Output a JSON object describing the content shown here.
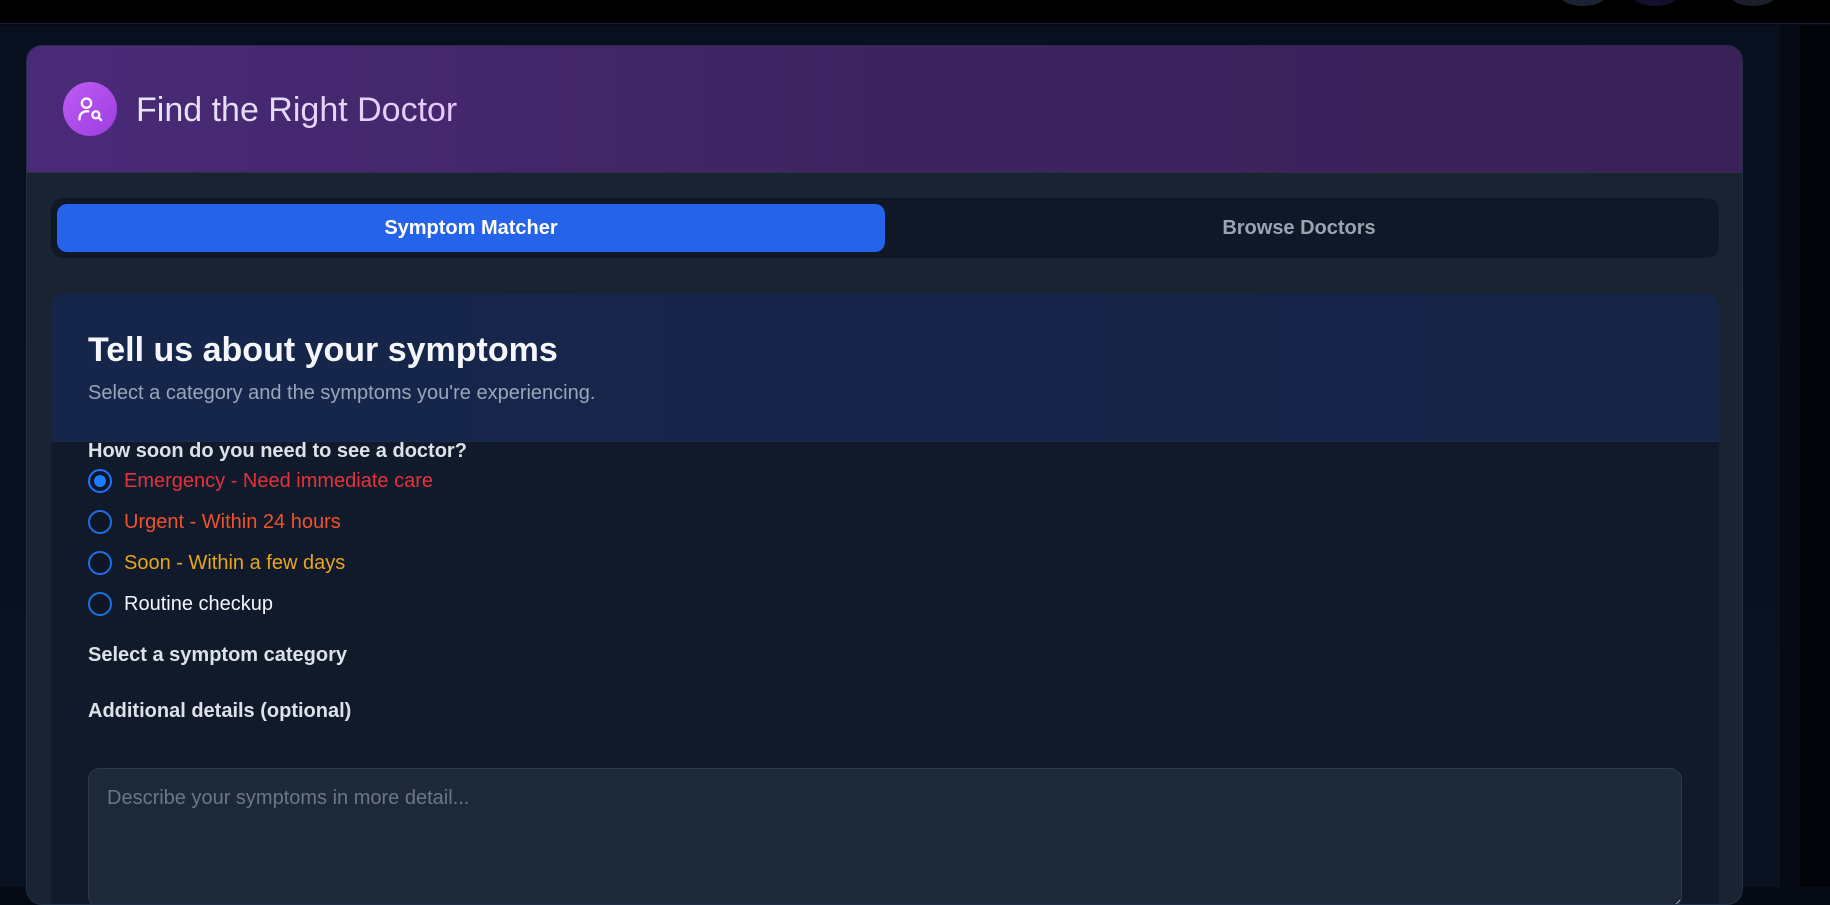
{
  "header": {
    "title": "Find the Right Doctor"
  },
  "tabs": [
    {
      "label": "Symptom Matcher",
      "active": true
    },
    {
      "label": "Browse Doctors",
      "active": false
    }
  ],
  "form": {
    "heading": "Tell us about your symptoms",
    "subheading": "Select a category and the symptoms you're experiencing.",
    "urgency": {
      "question": "How soon do you need to see a doctor?",
      "options": [
        {
          "label": "Emergency - Need immediate care",
          "color": "#e5323a",
          "selected": true
        },
        {
          "label": "Urgent - Within 24 hours",
          "color": "#f0522a",
          "selected": false
        },
        {
          "label": "Soon - Within a few days",
          "color": "#e8a51e",
          "selected": false
        },
        {
          "label": "Routine checkup",
          "color": "#f4f6fb",
          "selected": false
        }
      ]
    },
    "category_label": "Select a symptom category",
    "details": {
      "label": "Additional details (optional)",
      "value": "",
      "placeholder": "Describe your symptoms in more detail..."
    }
  },
  "colors": {
    "accent": "#2563eb",
    "header_gradient_start": "#4a2a78",
    "icon_gradient": "#c05cf5"
  },
  "icons": {
    "header_icon": "user-search-icon"
  }
}
